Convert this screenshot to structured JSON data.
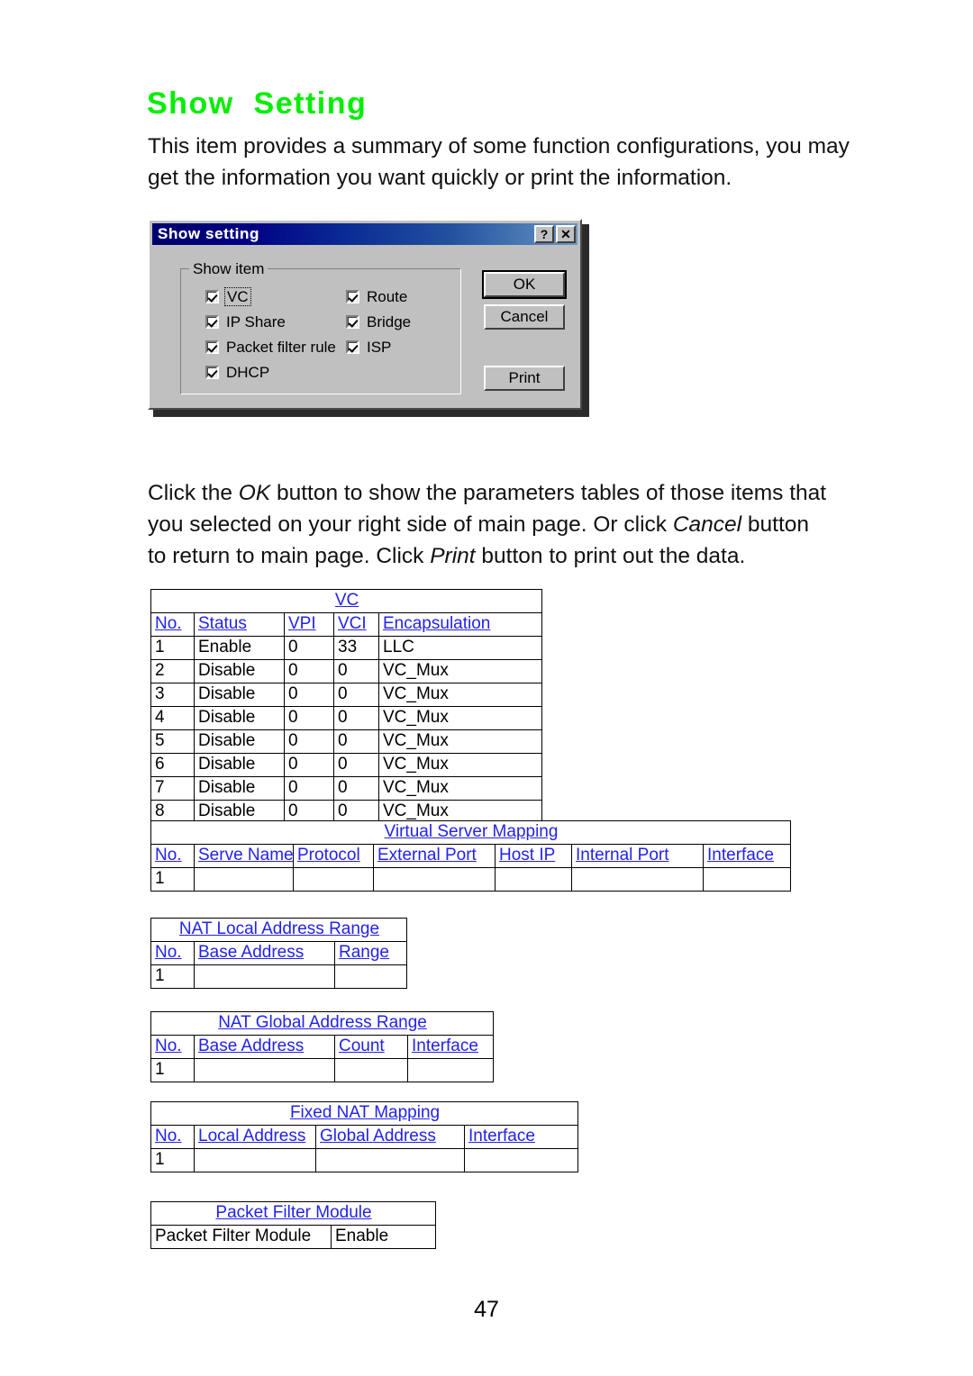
{
  "document": {
    "heading": "Show  Setting",
    "intro_lines": [
      "This item provides a summary of some function configurations, you may",
      "get the information you want quickly or print the information."
    ],
    "after_dialog_lines": [
      "Click the OK button to show the parameters tables of those items that",
      "you selected on your right side of main page.  Or click Cancel button",
      "to return to main page.  Click Print button to print out the data."
    ],
    "page_number": "47",
    "heading_color": "#00ee00",
    "table_heading_color": "#2222ee"
  },
  "paragraph_after": {
    "l1_a": "Click the ",
    "l1_em": "OK",
    "l1_b": " button to show the parameters tables of those items that",
    "l2_a": "you selected on your right side of main page.  Or click ",
    "l2_em": "Cancel",
    "l2_b": " button",
    "l3_a": "to return to main page.  Click ",
    "l3_em": "Print",
    "l3_b": " button to print out the data."
  },
  "dialog": {
    "title": "Show setting",
    "help_button": "?",
    "close_button": "✕",
    "group_label": "Show item",
    "checkboxes_left": [
      {
        "label": "VC",
        "checked": true,
        "focused": true
      },
      {
        "label": "IP Share",
        "checked": true,
        "focused": false
      },
      {
        "label": "Packet filter rule",
        "checked": true,
        "focused": false
      },
      {
        "label": "DHCP",
        "checked": true,
        "focused": false
      }
    ],
    "checkboxes_right": [
      {
        "label": "Route",
        "checked": true,
        "focused": false
      },
      {
        "label": "Bridge",
        "checked": true,
        "focused": false
      },
      {
        "label": "ISP",
        "checked": true,
        "focused": false
      }
    ],
    "buttons": {
      "ok": "OK",
      "cancel": "Cancel",
      "print": "Print"
    }
  },
  "tables": {
    "vc": {
      "title": "VC",
      "headers": [
        "No.",
        "Status",
        "VPI",
        "VCI",
        "Encapsulation"
      ],
      "rows": [
        [
          "1",
          "Enable",
          "0",
          "33",
          "LLC"
        ],
        [
          "2",
          "Disable",
          "0",
          "0",
          "VC_Mux"
        ],
        [
          "3",
          "Disable",
          "0",
          "0",
          "VC_Mux"
        ],
        [
          "4",
          "Disable",
          "0",
          "0",
          "VC_Mux"
        ],
        [
          "5",
          "Disable",
          "0",
          "0",
          "VC_Mux"
        ],
        [
          "6",
          "Disable",
          "0",
          "0",
          "VC_Mux"
        ],
        [
          "7",
          "Disable",
          "0",
          "0",
          "VC_Mux"
        ],
        [
          "8",
          "Disable",
          "0",
          "0",
          "VC_Mux"
        ]
      ]
    },
    "virtual_server_mapping": {
      "title": "Virtual Server Mapping",
      "headers": [
        "No.",
        "Serve Name",
        "Protocol",
        "External Port",
        "Host IP",
        "Internal Port",
        "Interface"
      ],
      "rows": [
        [
          "1",
          "",
          "",
          "",
          "",
          "",
          ""
        ]
      ]
    },
    "nat_local_address_range": {
      "title": "NAT Local Address Range",
      "headers": [
        "No.",
        "Base Address",
        "Range"
      ],
      "rows": [
        [
          "1",
          "",
          ""
        ]
      ]
    },
    "nat_global_address_range": {
      "title": "NAT Global Address Range",
      "headers": [
        "No.",
        "Base Address",
        "Count",
        "Interface"
      ],
      "rows": [
        [
          "1",
          "",
          "",
          ""
        ]
      ]
    },
    "fixed_nat_mapping": {
      "title": "Fixed NAT Mapping",
      "headers": [
        "No.",
        "Local Address",
        "Global Address",
        "Interface"
      ],
      "rows": [
        [
          "1",
          "",
          "",
          ""
        ]
      ]
    },
    "packet_filter_module": {
      "title": "Packet Filter Module",
      "rows": [
        [
          "Packet Filter Module",
          "Enable"
        ]
      ]
    }
  }
}
